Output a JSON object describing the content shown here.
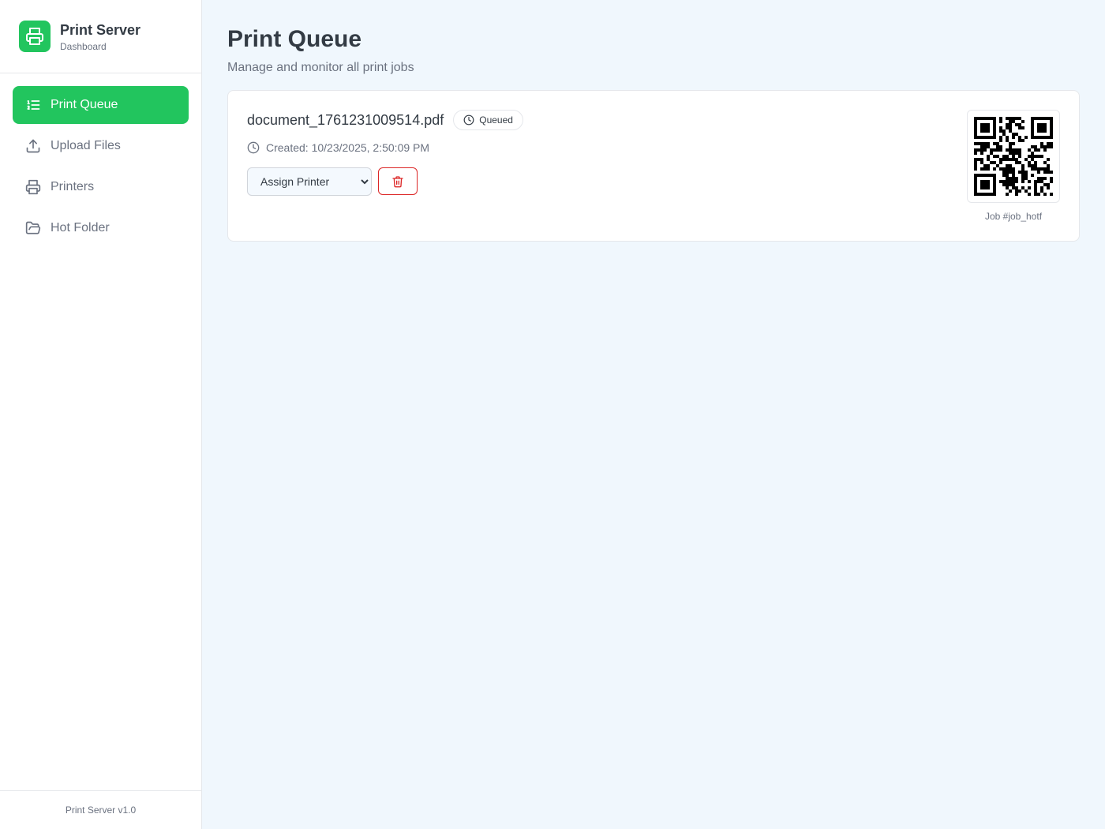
{
  "app": {
    "title": "Print Server",
    "subtitle": "Dashboard",
    "footer": "Print Server v1.0"
  },
  "nav": {
    "items": [
      {
        "label": "Print Queue",
        "icon": "list-ordered-icon",
        "active": true
      },
      {
        "label": "Upload Files",
        "icon": "upload-icon",
        "active": false
      },
      {
        "label": "Printers",
        "icon": "printer-icon",
        "active": false
      },
      {
        "label": "Hot Folder",
        "icon": "folder-open-icon",
        "active": false
      }
    ]
  },
  "page": {
    "title": "Print Queue",
    "subtitle": "Manage and monitor all print jobs"
  },
  "job": {
    "filename": "document_1761231009514.pdf",
    "status": "Queued",
    "created": "Created: 10/23/2025, 2:50:09 PM",
    "assign_printer_value": "Assign Printer",
    "job_label": "Job #job_hotf"
  },
  "colors": {
    "accent": "#22c55e",
    "danger": "#dc2626",
    "background": "#f0f7fd"
  }
}
